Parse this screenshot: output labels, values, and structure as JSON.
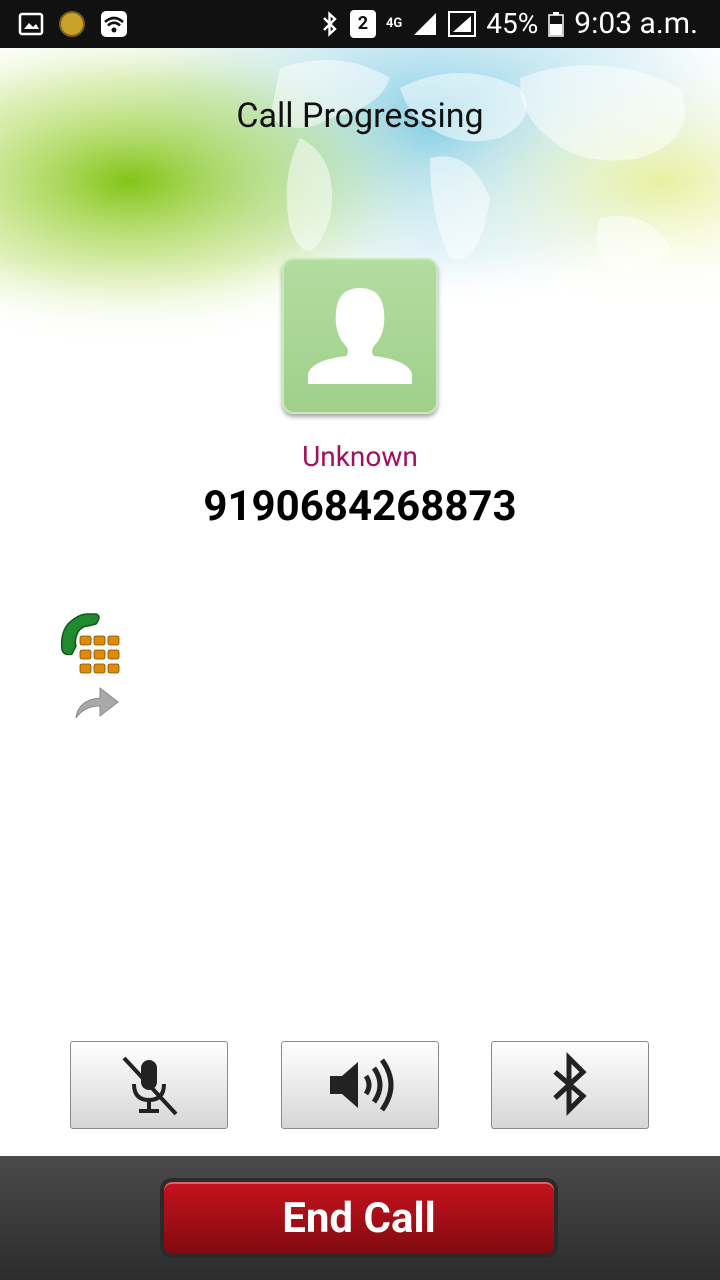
{
  "status_bar": {
    "sim_slot": "2",
    "network": "4G",
    "battery": "45%",
    "time": "9:03 a.m."
  },
  "call": {
    "title": "Call Progressing",
    "contact_name": "Unknown",
    "contact_number": "9190684268873"
  },
  "controls": {
    "mute": "mic-muted-icon",
    "speaker": "speaker-icon",
    "bluetooth": "bluetooth-icon"
  },
  "end_call_label": "End Call",
  "colors": {
    "contact_name": "#a3105c",
    "end_call": "#a50f17",
    "avatar": "#a8d592"
  }
}
